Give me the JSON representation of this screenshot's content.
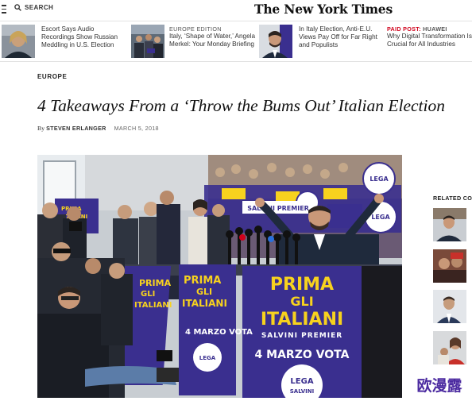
{
  "header": {
    "search_label": "SEARCH",
    "masthead": "The New York Times",
    "icons": [
      "hamburger-menu-icon",
      "search-icon"
    ]
  },
  "strip": {
    "items": [
      {
        "kicker": "",
        "headline": "Escort Says Audio Recordings Show Russian Meddling in U.S. Election"
      },
      {
        "kicker": "EUROPE EDITION",
        "headline": "Italy, ‘Shape of Water,’ Angela Merkel: Your Monday Briefing"
      },
      {
        "kicker": "",
        "headline": "In Italy Election, Anti-E.U. Views Pay Off for Far Right and Populists"
      },
      {
        "kicker_paid": "PAID POST:",
        "kicker_sponsor": "HUAWEI",
        "headline": "Why Digital Transformation Is Crucial for All Industries"
      }
    ]
  },
  "article": {
    "section": "EUROPE",
    "headline": "4 Takeaways From a ‘Throw the Bums Out’ Italian Election",
    "byline_prefix": "By",
    "author": "STEVEN ERLANGER",
    "date": "MARCH 5, 2018"
  },
  "photo": {
    "poster_main_line1": "PRIMA",
    "poster_main_line2": "GLI",
    "poster_main_line3": "ITALIANI",
    "poster_subline": "SALVINI PREMIER",
    "poster_date": "4 MARZO VOTA",
    "poster_logo_line1": "LEGA",
    "poster_logo_line2": "SALVINI",
    "poster_small_line1": "PRIMA",
    "poster_small_line2": "GLI",
    "poster_small_line3": "ITALIANI",
    "poster_small_date": "4 MARZO VOTA",
    "banner_text": "SALVINI PREMIER",
    "backdrop_text": "LEGA"
  },
  "sidebar": {
    "related_label": "RELATED CO"
  },
  "watermark": {
    "text": "欧漫露"
  },
  "colors": {
    "poster_purple": "#3a2f8f",
    "poster_yellow": "#f7d21e",
    "paid_red": "#d0021b",
    "watermark_purple": "#4b2aa0"
  }
}
